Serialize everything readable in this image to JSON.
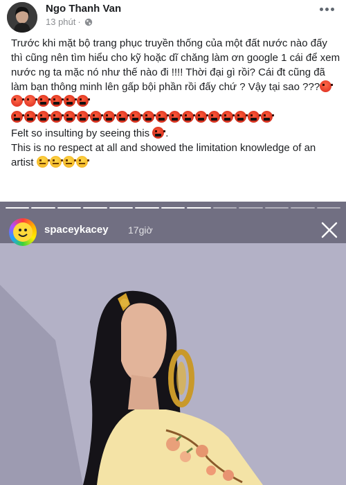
{
  "post": {
    "author_name": "Ngo Thanh Van",
    "timestamp": "13 phút",
    "separator": "·",
    "privacy_icon": "globe-icon",
    "more_icon": "more-options-icon"
  },
  "body": {
    "paragraph_vi": "Trước khi mặt bộ trang phục truyền thống của một đất nước nào đấy thì cũng nên tìm hiểu cho kỹ hoặc dĩ chăng làm ơn google 1 cái để xem nước ng ta mặc nó như thế nào đi !!!! Thời đại gì rồi? Cái đt cũng đã làm bạn thông minh lên gấp bội phần rồi đấy chứ ? Vậy tại sao ???",
    "line_en_1": "Felt so insulting by seeing this",
    "line_en_2": "This is no respect at all and showed the limitation knowledge of an artist",
    "emoji_names": [
      "angry-face-emoji",
      "cursing-face-emoji",
      "face-with-steam-emoji"
    ]
  },
  "story": {
    "username": "spaceykacey",
    "time": "17giờ",
    "close_icon": "close-icon",
    "colors": {
      "dress": "#f4e3a6",
      "background": "#b0aec3"
    }
  }
}
